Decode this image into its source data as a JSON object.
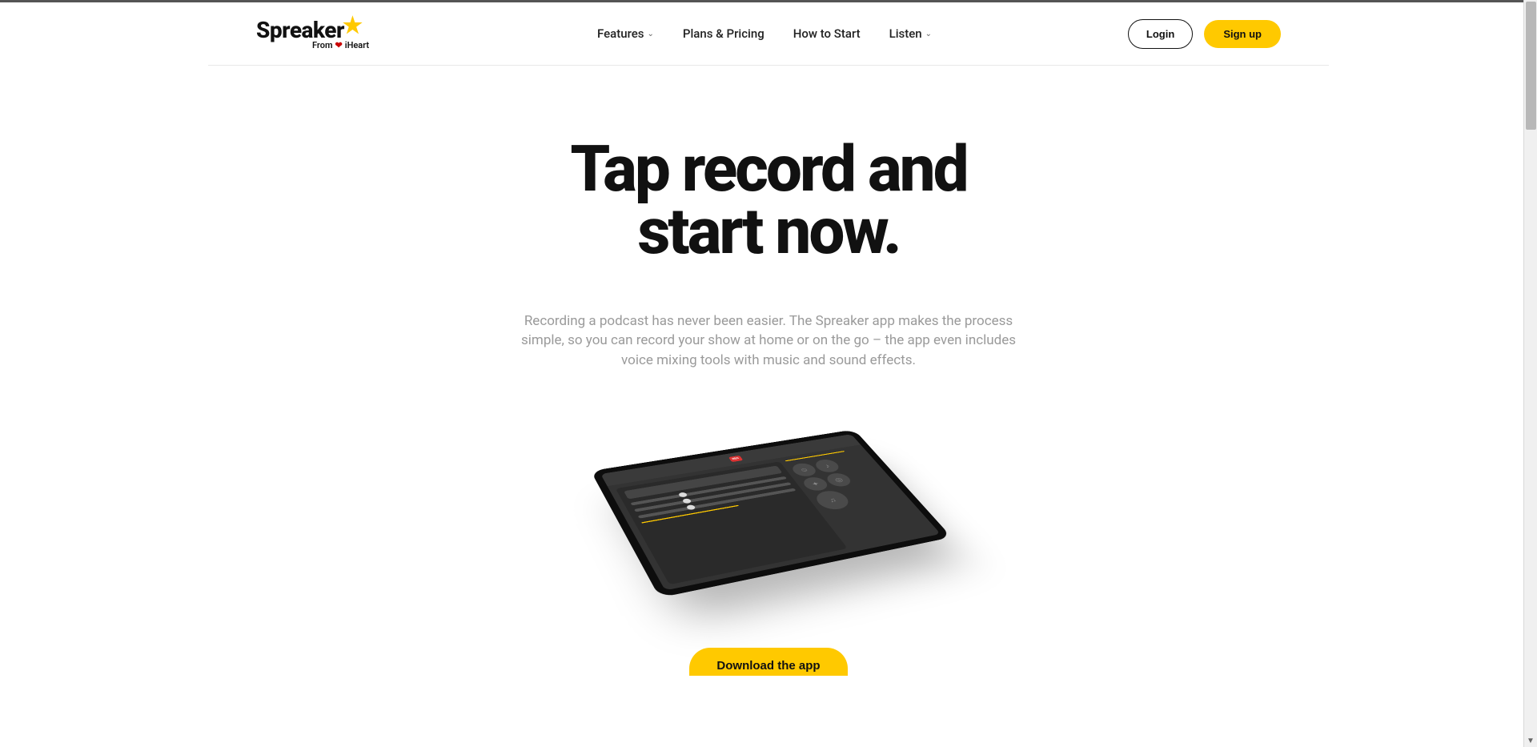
{
  "brand": {
    "name": "Spreaker",
    "from_label": "From",
    "sub_brand": "iHeart"
  },
  "nav": {
    "features": "Features",
    "plans": "Plans & Pricing",
    "howto": "How to Start",
    "listen": "Listen"
  },
  "auth": {
    "login": "Login",
    "signup": "Sign up"
  },
  "hero": {
    "title_line1": "Tap record and",
    "title_line2": "start now.",
    "subtitle": "Recording a podcast has never been easier. The Spreaker app makes the process simple, so you can record your show at home or on the go – the app even includes voice mixing tools with music and sound effects.",
    "rec_label": "REC",
    "cta": "Download the app"
  }
}
